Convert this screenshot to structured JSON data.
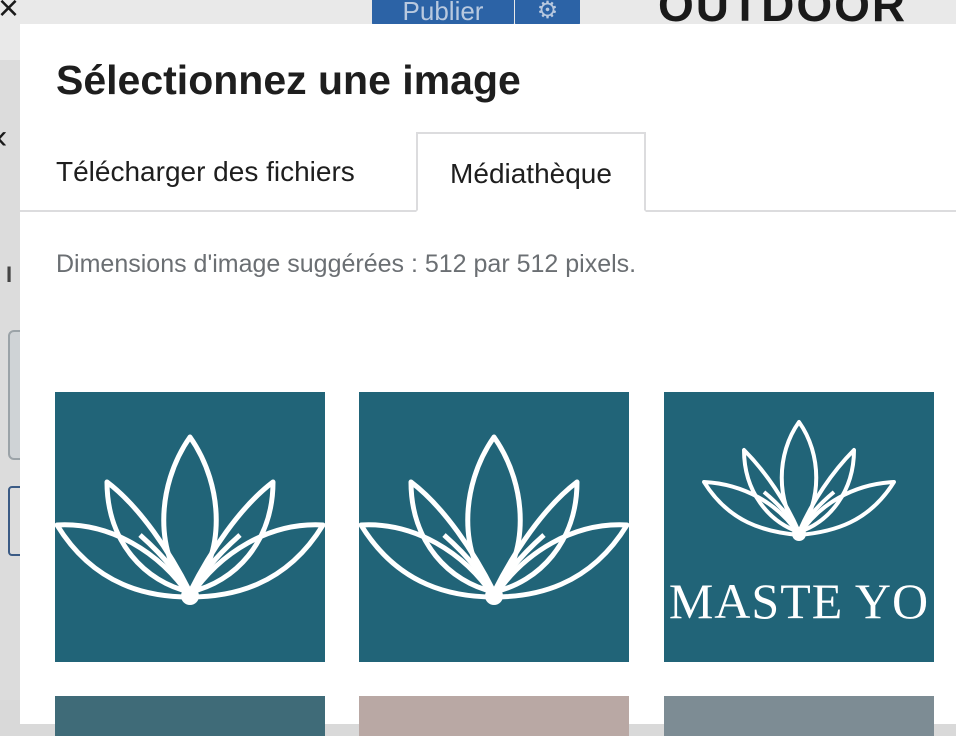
{
  "background": {
    "publish_label": "Publier",
    "brand_text": "OUTDOOR",
    "close_glyph": "×",
    "back_glyph": "‹",
    "partial_letter": "I"
  },
  "modal": {
    "title": "Sélectionnez une image",
    "tabs": [
      {
        "label": "Télécharger des fichiers",
        "active": false
      },
      {
        "label": "Médiathèque",
        "active": true
      }
    ],
    "hint": "Dimensions d'image suggérées : 512 par 512 pixels.",
    "thumbnails": [
      {
        "alt_icon": "lotus-icon",
        "text": ""
      },
      {
        "alt_icon": "lotus-icon",
        "text": ""
      },
      {
        "alt_icon": "lotus-icon",
        "text": "MASTE YO"
      }
    ]
  },
  "colors": {
    "thumb_bg": "#216478",
    "publish_blue": "#2c63a6",
    "lotus_line": "#ffffff"
  }
}
